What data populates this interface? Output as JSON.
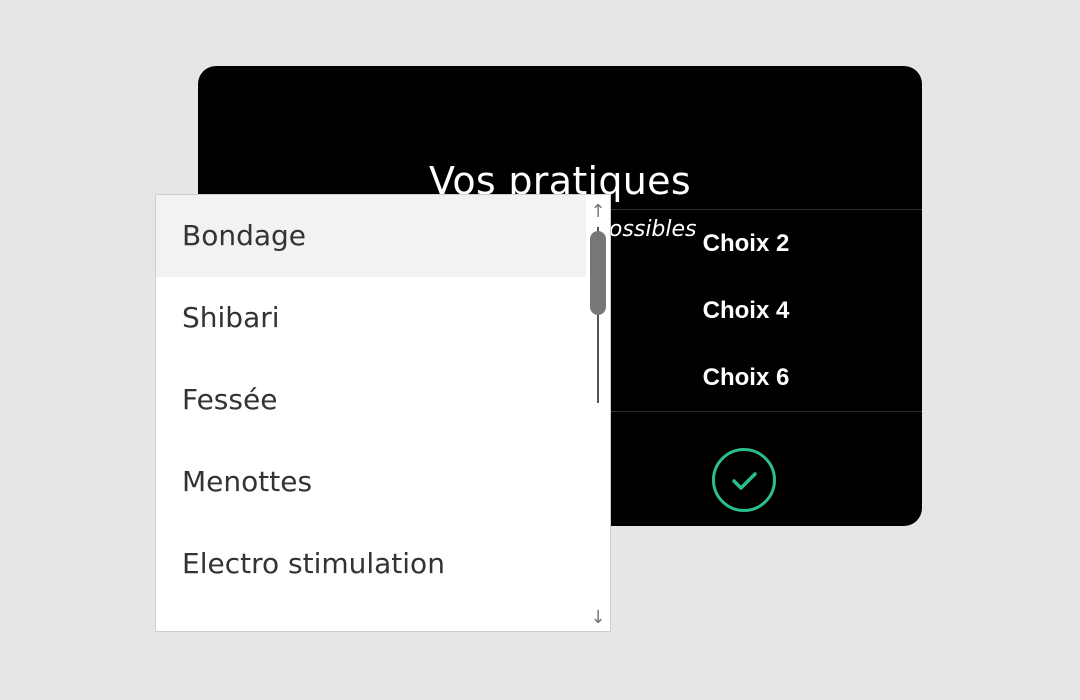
{
  "dialog": {
    "title": "Vos pratiques",
    "subtitle": "Plusieurs choix possibles",
    "choices": [
      "Choix 2",
      "Choix 4",
      "Choix 6"
    ],
    "confirm_icon": "check-circle-icon",
    "accent_color": "#2dbd8b"
  },
  "dropdown": {
    "options": [
      "Bondage",
      "Shibari",
      "Fessée",
      "Menottes",
      "Electro stimulation"
    ],
    "highlighted_option": "Bondage",
    "scroll_up_icon": "↑",
    "scroll_down_icon": "↓"
  }
}
